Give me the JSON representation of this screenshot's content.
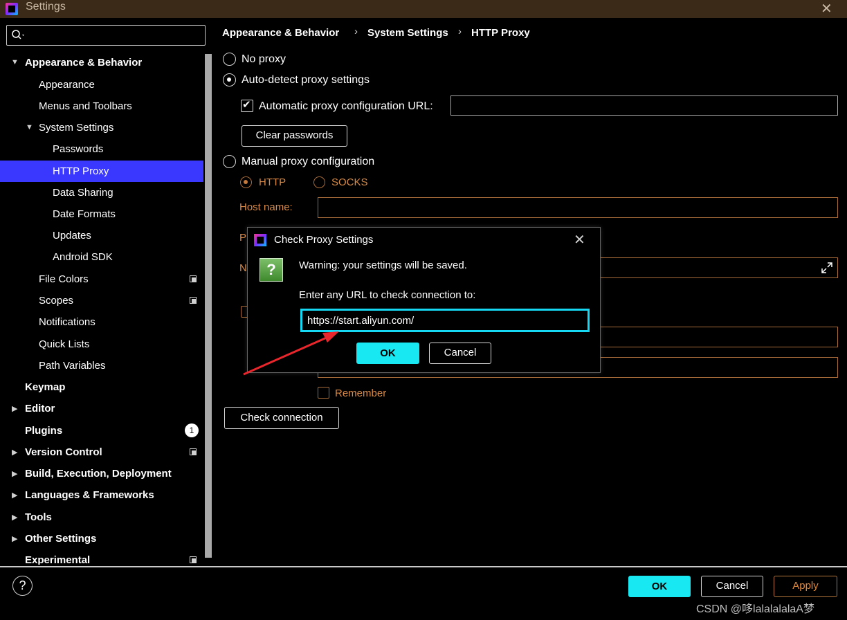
{
  "window": {
    "title": "Settings"
  },
  "search": {
    "placeholder": ""
  },
  "sidebar": {
    "items": [
      {
        "label": "Appearance & Behavior"
      },
      {
        "label": "Appearance"
      },
      {
        "label": "Menus and Toolbars"
      },
      {
        "label": "System Settings"
      },
      {
        "label": "Passwords"
      },
      {
        "label": "HTTP Proxy"
      },
      {
        "label": "Data Sharing"
      },
      {
        "label": "Date Formats"
      },
      {
        "label": "Updates"
      },
      {
        "label": "Android SDK"
      },
      {
        "label": "File Colors"
      },
      {
        "label": "Scopes"
      },
      {
        "label": "Notifications"
      },
      {
        "label": "Quick Lists"
      },
      {
        "label": "Path Variables"
      },
      {
        "label": "Keymap"
      },
      {
        "label": "Editor"
      },
      {
        "label": "Plugins",
        "badge": "1"
      },
      {
        "label": "Version Control"
      },
      {
        "label": "Build, Execution, Deployment"
      },
      {
        "label": "Languages & Frameworks"
      },
      {
        "label": "Tools"
      },
      {
        "label": "Other Settings"
      },
      {
        "label": "Experimental"
      }
    ]
  },
  "breadcrumb": [
    "Appearance & Behavior",
    "System Settings",
    "HTTP Proxy"
  ],
  "proxy": {
    "no_proxy": "No proxy",
    "auto_detect": "Auto-detect proxy settings",
    "auto_url_label": "Automatic proxy configuration URL:",
    "auto_url_value": "",
    "clear_passwords": "Clear passwords",
    "manual": "Manual proxy configuration",
    "http": "HTTP",
    "socks": "SOCKS",
    "host_name": "Host name:",
    "port_partial": "P",
    "no_proxy_partial": "N",
    "remember": "Remember",
    "check_connection": "Check connection"
  },
  "dialog": {
    "title": "Check Proxy Settings",
    "warning": "Warning: your settings will be saved.",
    "prompt": "Enter any URL to check connection to:",
    "url": "https://start.aliyun.com/",
    "ok": "OK",
    "cancel": "Cancel"
  },
  "footer": {
    "help": "?",
    "ok": "OK",
    "cancel": "Cancel",
    "apply": "Apply",
    "watermark": "CSDN @哆lalalalalaA梦"
  },
  "colors": {
    "accent": "#17e8f2",
    "selection": "#3a38ff",
    "warning_orange": "#d98a46",
    "arrow_red": "#e8262b"
  },
  "icons": [
    "search-icon",
    "close-icon",
    "question-icon",
    "expand-icon",
    "copy-icon",
    "help-icon"
  ]
}
